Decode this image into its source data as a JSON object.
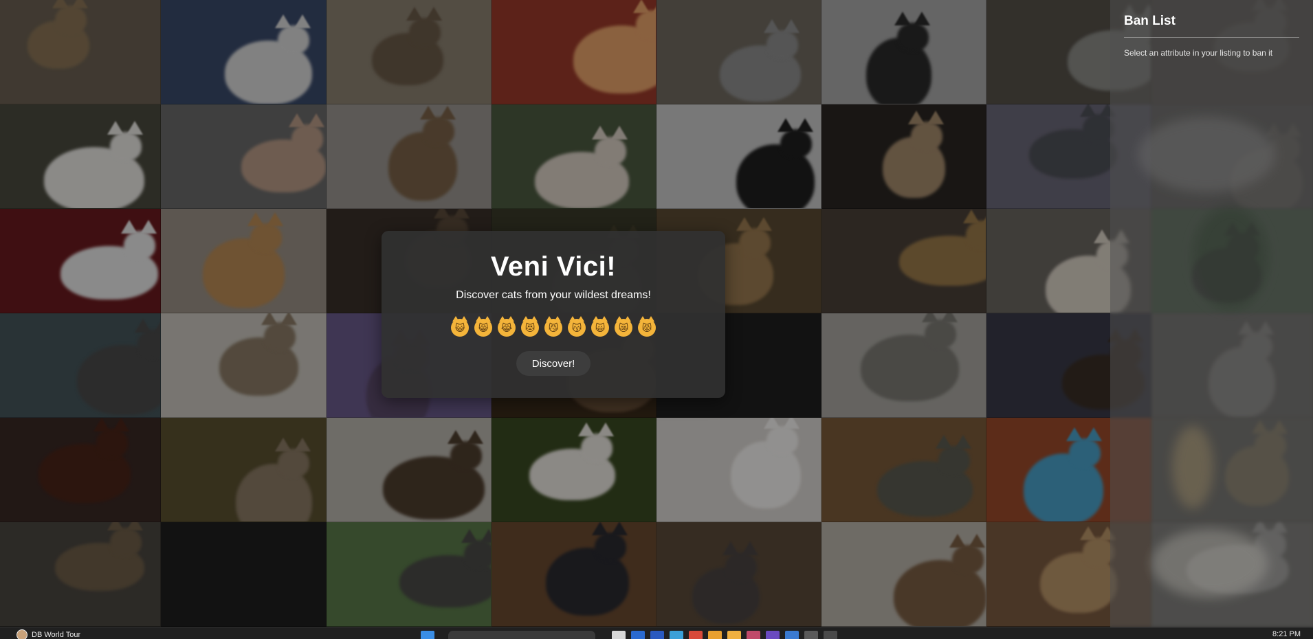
{
  "ban_list": {
    "title": "Ban List",
    "hint": "Select an attribute in your listing to ban it"
  },
  "card": {
    "title": "Veni Vici!",
    "subtitle": "Discover cats from your wildest dreams!",
    "emojis": [
      "😺",
      "😸",
      "😹",
      "😻",
      "😼",
      "😽",
      "🙀",
      "😿",
      "😾"
    ],
    "discover_label": "Discover!"
  },
  "taskbar": {
    "app_label": "DB World Tour",
    "time": "8:21 PM"
  },
  "colors": {
    "card_background": "#303030",
    "panel_background": "#3c3c3c",
    "emoji_face": "#f4b43a",
    "button_background": "#3d3d3d"
  },
  "gallery": {
    "tiles": [
      {
        "bg": "#6b6052",
        "cat": "#8a7456"
      },
      {
        "bg": "#3a4a6a",
        "cat": "#d8d8d8"
      },
      {
        "bg": "#8a8070",
        "cat": "#6a5a48"
      },
      {
        "bg": "#9a3a2a",
        "cat": "#e7a26a"
      },
      {
        "bg": "#706a60",
        "cat": "#8e8e8e"
      },
      {
        "bg": "#a8a8a8",
        "cat": "#2a2a2a"
      },
      {
        "bg": "#555049",
        "cat": "#8a8a85"
      },
      {
        "bg": "#5c5550",
        "cat": "#6e6a65"
      },
      {
        "bg": "#4a4a3e",
        "cat": "#e8e6e2"
      },
      {
        "bg": "#6a6a6a",
        "cat": "#b89a86"
      },
      {
        "bg": "#9a9590",
        "cat": "#7a6248"
      },
      {
        "bg": "#4c5a40",
        "cat": "#d9cfc4"
      },
      {
        "bg": "#c8c8c8",
        "cat": "#1e1e1e"
      },
      {
        "bg": "#2a2622",
        "cat": "#a48a6c"
      },
      {
        "bg": "#6a6878",
        "cat": "#4e5058"
      },
      {
        "bg": "#5e5c5a",
        "cat": "#75706a"
      },
      {
        "bg": "#6a1a1e",
        "cat": "#e6e6e6"
      },
      {
        "bg": "#9a9085",
        "cat": "#b98a55"
      },
      {
        "bg": "#3a3028",
        "cat": "#5a4a3a"
      },
      {
        "bg": "#3a3a28",
        "cat": "#4a4530"
      },
      {
        "bg": "#5a4a32",
        "cat": "#9a7a50"
      },
      {
        "bg": "#4a4038",
        "cat": "#9a7a4a"
      },
      {
        "bg": "#6a6660",
        "cat": "#d8d0c4"
      },
      {
        "bg": "#4e6a4e",
        "cat": "#3a3a3a"
      },
      {
        "bg": "#45555a",
        "cat": "#4a4a4a"
      },
      {
        "bg": "#c8c4bc",
        "cat": "#8a7a66"
      },
      {
        "bg": "#6a5a8a",
        "cat": "#5a4a6a"
      },
      {
        "bg": "#3a2a1a",
        "cat": "#6a5038"
      },
      {
        "bg": "#1e1e1e",
        "cat": "#1e1e1e"
      },
      {
        "bg": "#a8a6a0",
        "cat": "#7c7a74"
      },
      {
        "bg": "#3a3a48",
        "cat": "#3a2e26"
      },
      {
        "bg": "#6a6864",
        "cat": "#9c9a96"
      },
      {
        "bg": "#3a2824",
        "cat": "#4a2418"
      },
      {
        "bg": "#5a5030",
        "cat": "#8a7a64"
      },
      {
        "bg": "#b8b4ac",
        "cat": "#4e3e2e"
      },
      {
        "bg": "#3a4a22",
        "cat": "#e8e4de"
      },
      {
        "bg": "#d8d4d0",
        "cat": "#f2f0ee"
      },
      {
        "bg": "#7a5a3a",
        "cat": "#5a5a50"
      },
      {
        "bg": "#9a4a2a",
        "cat": "#4aa0c8"
      },
      {
        "bg": "#6a6860",
        "cat": "#9a8a66"
      },
      {
        "bg": "#4a4640",
        "cat": "#6e5e48"
      },
      {
        "bg": "#1e1e1e",
        "cat": "#1e1e1e"
      },
      {
        "bg": "#5a7a4a",
        "cat": "#4a4a46"
      },
      {
        "bg": "#6a4a30",
        "cat": "#2a2a30"
      },
      {
        "bg": "#5a4a3a",
        "cat": "#4a4442"
      },
      {
        "bg": "#b8b2a8",
        "cat": "#7a5e44"
      },
      {
        "bg": "#7a5a40",
        "cat": "#b89468"
      },
      {
        "bg": "#7a7872",
        "cat": "#c4c2be"
      }
    ]
  }
}
